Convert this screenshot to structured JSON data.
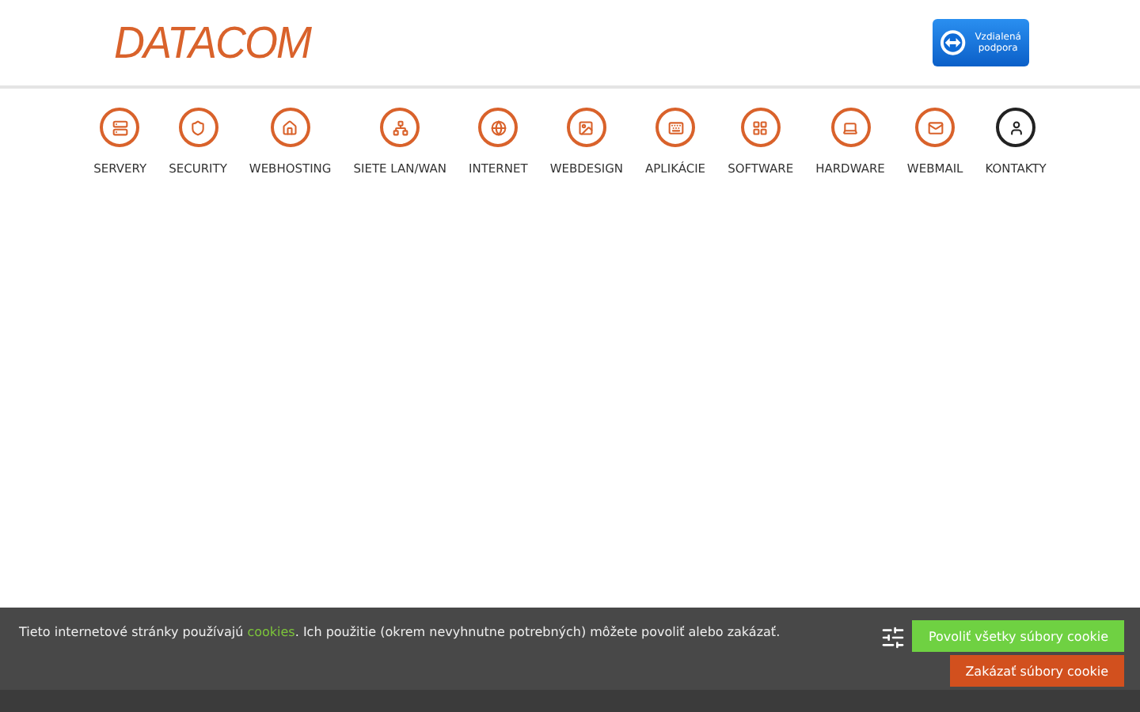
{
  "header": {
    "logo": "DATACOM",
    "support_badge": {
      "label": "Vzdialená podpora"
    }
  },
  "nav": [
    {
      "label": "SERVERY",
      "selected": false
    },
    {
      "label": "SECURITY",
      "selected": false
    },
    {
      "label": "WEBHOSTING",
      "selected": false
    },
    {
      "label": "SIETE LAN/WAN",
      "selected": false
    },
    {
      "label": "INTERNET",
      "selected": false
    },
    {
      "label": "WEBDESIGN",
      "selected": false
    },
    {
      "label": "APLIKÁCIE",
      "selected": false
    },
    {
      "label": "SOFTWARE",
      "selected": false
    },
    {
      "label": "HARDWARE",
      "selected": false
    },
    {
      "label": "WEBMAIL",
      "selected": false
    },
    {
      "label": "KONTAKTY",
      "selected": true
    }
  ],
  "cookie_bar": {
    "text_before": "Tieto internetové stránky používajú",
    "link": "cookies",
    "text_after": ". Ich použitie (okrem nevyhnutne potrebných) môžete povoliť alebo zakázať.",
    "buttons": [
      {
        "label": "Povoliť všetky súbory cookie",
        "kind": "accept"
      },
      {
        "label": "Zakázať súbory cookie",
        "kind": "reject"
      }
    ]
  }
}
